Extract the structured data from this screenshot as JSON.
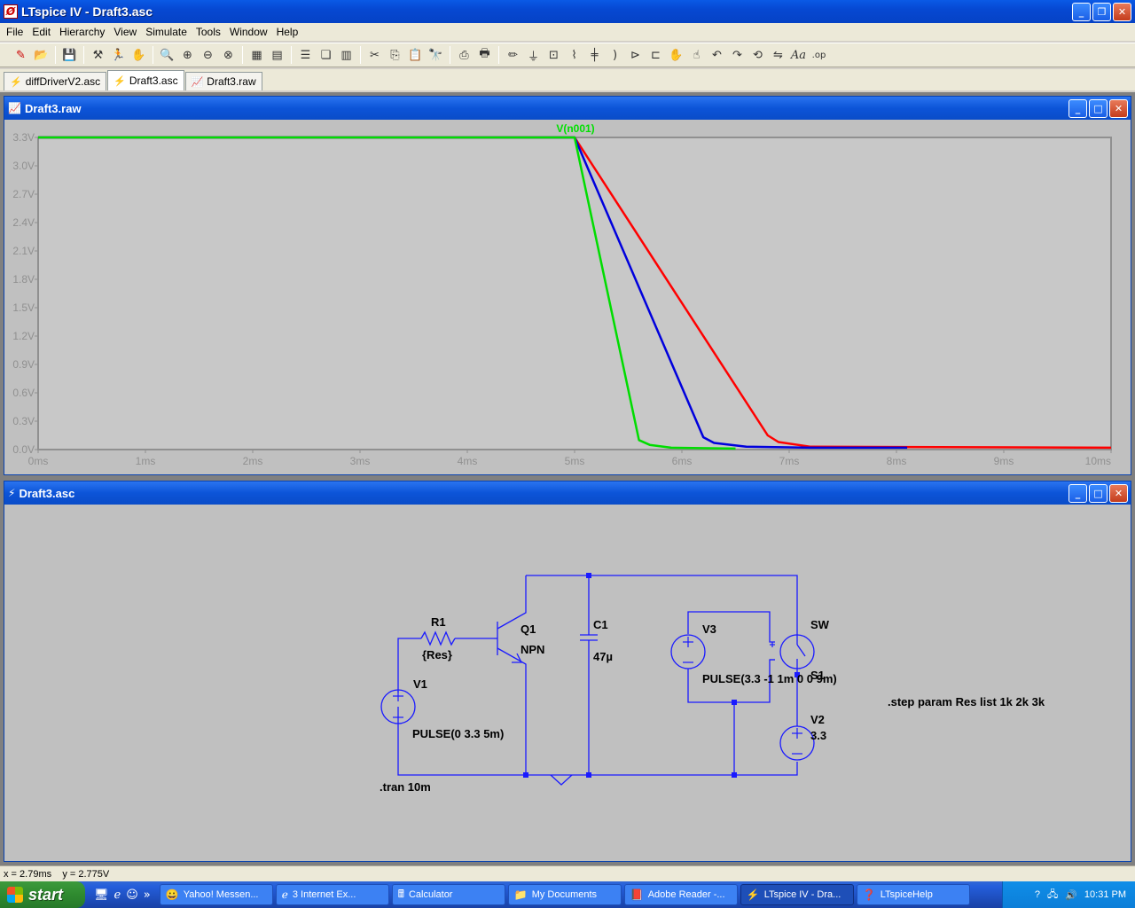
{
  "window": {
    "title": "LTspice IV - Draft3.asc"
  },
  "menu": [
    "File",
    "Edit",
    "Hierarchy",
    "View",
    "Simulate",
    "Tools",
    "Window",
    "Help"
  ],
  "tabs": [
    {
      "label": "diffDriverV2.asc",
      "icon": "schematic-icon"
    },
    {
      "label": "Draft3.asc",
      "icon": "schematic-icon"
    },
    {
      "label": "Draft3.raw",
      "icon": "waveform-icon"
    }
  ],
  "plot_window": {
    "title": "Draft3.raw"
  },
  "schematic_window": {
    "title": "Draft3.asc"
  },
  "chart_data": {
    "type": "line",
    "title": "V(n001)",
    "xlabel": "",
    "ylabel": "",
    "x_ticks": [
      "0ms",
      "1ms",
      "2ms",
      "3ms",
      "4ms",
      "5ms",
      "6ms",
      "7ms",
      "8ms",
      "9ms",
      "10ms"
    ],
    "y_ticks": [
      "0.0V",
      "0.3V",
      "0.6V",
      "0.9V",
      "1.2V",
      "1.5V",
      "1.8V",
      "2.1V",
      "2.4V",
      "2.7V",
      "3.0V",
      "3.3V"
    ],
    "xlim": [
      0,
      10
    ],
    "ylim": [
      0,
      3.3
    ],
    "grid": false,
    "series": [
      {
        "color": "#ff0000",
        "x": [
          0,
          5.0,
          6.8,
          6.9,
          7.2,
          10
        ],
        "y": [
          3.3,
          3.3,
          0.15,
          0.08,
          0.03,
          0.02
        ]
      },
      {
        "color": "#0000dd",
        "x": [
          0,
          5.0,
          6.2,
          6.3,
          6.6,
          7.2,
          8.1
        ],
        "y": [
          3.3,
          3.3,
          0.13,
          0.07,
          0.03,
          0.02,
          0.02
        ]
      },
      {
        "color": "#00dd00",
        "x": [
          0,
          5.0,
          5.6,
          5.7,
          5.9,
          6.5
        ],
        "y": [
          3.3,
          3.3,
          0.1,
          0.05,
          0.02,
          0.01
        ]
      }
    ]
  },
  "schematic": {
    "R1_name": "R1",
    "R1_value": "{Res}",
    "Q1_name": "Q1",
    "Q1_model": "NPN",
    "C1_name": "C1",
    "C1_value": "47µ",
    "V1_name": "V1",
    "V1_value": "PULSE(0 3.3 5m)",
    "V3_name": "V3",
    "V3_value": "PULSE(3.3 -1 1m 0 0 9m)",
    "SW_model": "SW",
    "S1_name": "S1",
    "V2_name": "V2",
    "V2_value": "3.3",
    "tran": ".tran 10m",
    "step": ".step param Res list 1k 2k 3k"
  },
  "status": "x = 2.79ms    y = 2.775V",
  "taskbar": {
    "start": "start",
    "items": [
      {
        "label": "Yahoo! Messen...",
        "icon": "smiley-icon"
      },
      {
        "label": "3 Internet Ex...",
        "icon": "ie-icon"
      },
      {
        "label": "Calculator",
        "icon": "calculator-icon"
      },
      {
        "label": "My Documents",
        "icon": "folder-icon"
      },
      {
        "label": "Adobe Reader -...",
        "icon": "pdf-icon"
      },
      {
        "label": "LTspice IV - Dra...",
        "icon": "ltspice-icon"
      },
      {
        "label": "LTspiceHelp",
        "icon": "help-icon"
      }
    ],
    "clock": "10:31 PM"
  }
}
